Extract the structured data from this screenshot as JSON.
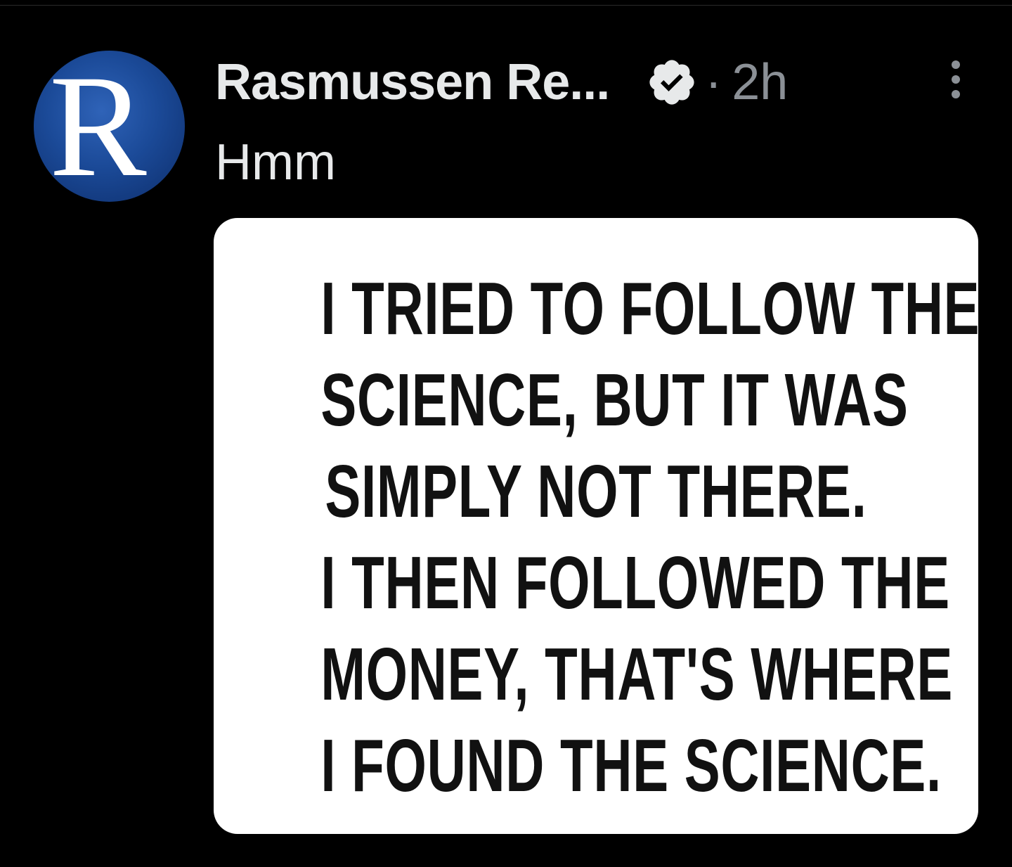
{
  "post": {
    "author": {
      "name": "Rasmussen Re...",
      "avatar_letter": "R",
      "avatar_color": "#1b4a98",
      "verified_icon": "verified-badge-icon"
    },
    "separator": "·",
    "timestamp": "2h",
    "more_icon": "more-vertical-icon",
    "text": "Hmm",
    "media": {
      "lines": [
        "I TRIED TO FOLLOW THE",
        "SCIENCE, BUT IT WAS",
        "SIMPLY NOT THERE.",
        "I THEN FOLLOWED THE",
        "MONEY, THAT'S WHERE",
        "I FOUND THE SCIENCE."
      ]
    }
  },
  "colors": {
    "background": "#000000",
    "primary_text": "#e7e9ea",
    "secondary_text": "#8b9096",
    "media_background": "#ffffff"
  }
}
